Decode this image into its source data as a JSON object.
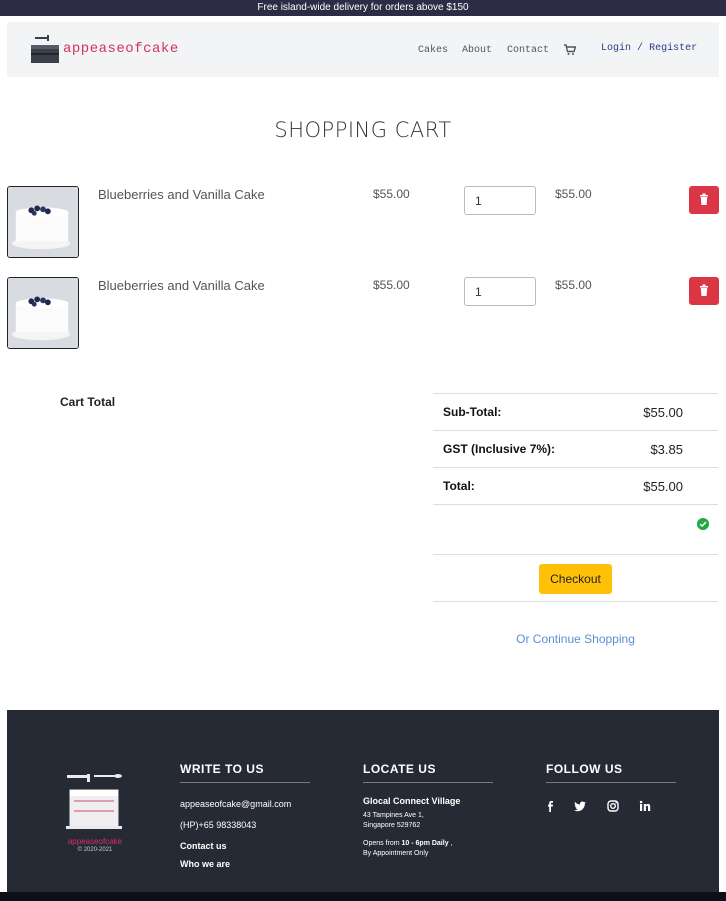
{
  "announcement": "Free island-wide delivery for orders above $150",
  "brand": {
    "name": "appeaseofcake"
  },
  "nav": {
    "cakes": "Cakes",
    "about": "About",
    "contact": "Contact",
    "login": "Login",
    "separator": "/",
    "register": "Register"
  },
  "page_title": "SHOPPING CART",
  "cart_items": [
    {
      "name": "Blueberries and Vanilla Cake",
      "price": "$55.00",
      "quantity": "1",
      "total": "$55.00"
    },
    {
      "name": "Blueberries and Vanilla Cake",
      "price": "$55.00",
      "quantity": "1",
      "total": "$55.00"
    }
  ],
  "summary": {
    "cart_total_label": "Cart Total",
    "subtotal_label": "Sub-Total:",
    "subtotal_value": "$55.00",
    "gst_label": "GST (Inclusive 7%):",
    "gst_value": "$3.85",
    "total_label": "Total:",
    "total_value": "$55.00",
    "checkout_label": "Checkout",
    "continue_label": "Or Continue Shopping"
  },
  "footer": {
    "brand_name": "appeaseofcake",
    "copyright": "© 2020-2021",
    "write_heading": "WRITE TO US",
    "email": "appeaseofcake@gmail.com",
    "phone": "(HP)+65 98338043",
    "contact_link": "Contact us",
    "who_link": "Who we are",
    "locate_heading": "LOCATE US",
    "venue": "Glocal Connect Village",
    "address_line1": "43 Tampines Ave 1,",
    "address_line2": "Singapore 529762",
    "hours_prefix": "Opens from ",
    "hours": "10 - 6pm Daily",
    "hours_suffix": " ,",
    "appointment": "By Appointment Only",
    "follow_heading": "FOLLOW US"
  },
  "colors": {
    "brand": "#d6315d",
    "topbar": "#2c2c44",
    "footer": "#252a35",
    "danger": "#dc3545",
    "checkout": "#ffc107",
    "success": "#28a745",
    "link": "#5b8fd6"
  },
  "icons": {
    "cart": "shopping-cart-icon",
    "delete": "trash-icon",
    "verified": "check-circle-icon",
    "facebook": "facebook-icon",
    "twitter": "twitter-icon",
    "instagram": "instagram-icon",
    "linkedin": "linkedin-icon"
  }
}
